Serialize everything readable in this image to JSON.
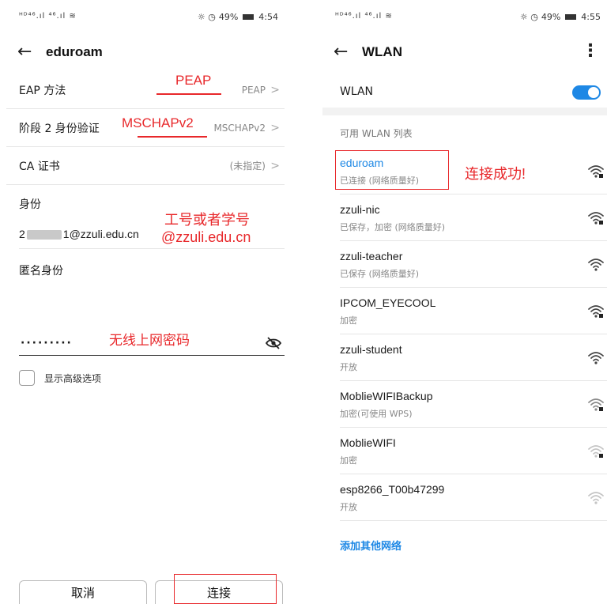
{
  "left": {
    "status": {
      "signal": "ᴴᴰ⁴⁶.ıl ⁴⁶.ıl ≋",
      "right": "49%",
      "icons": "☼ ◷",
      "time": "4:54"
    },
    "header": {
      "back_icon": "←",
      "title": "eduroam"
    },
    "rows": [
      {
        "label": "EAP 方法",
        "value": "PEAP",
        "chevron": ">"
      },
      {
        "label": "阶段 2 身份验证",
        "value": "MSCHAPv2",
        "chevron": ">"
      },
      {
        "label": "CA 证书",
        "value": "(未指定)",
        "chevron": ">"
      }
    ],
    "identity_label": "身份",
    "identity_prefix": "2",
    "identity_suffix": "1@zzuli.edu.cn",
    "anon_label": "匿名身份",
    "password_dots": "·········",
    "checkbox_label": "显示高级选项",
    "cancel_label": "取消",
    "connect_label": "连接",
    "annotations": {
      "peap": "PEAP",
      "mschap": "MSCHAPv2",
      "id_hint_line1": "工号或者学号",
      "id_hint_line2": "@zzuli.edu.cn",
      "password_hint": "无线上网密码"
    }
  },
  "right": {
    "status": {
      "signal": "ᴴᴰ⁴⁶.ıl ⁴⁶.ıl ≋",
      "right": "49%",
      "icons": "☼ ◷",
      "time": "4:55"
    },
    "header": {
      "back_icon": "←",
      "title": "WLAN",
      "menu_icon": "⋮"
    },
    "wlan_label": "WLAN",
    "toggle_on": true,
    "section_title": "可用 WLAN 列表",
    "success_annotation": "连接成功!",
    "networks": [
      {
        "name": "eduroam",
        "status": "已连接 (网络质量好)",
        "secured": true,
        "strength": "strong"
      },
      {
        "name": "zzuli-nic",
        "status": "已保存，加密 (网络质量好)",
        "secured": true,
        "strength": "strong"
      },
      {
        "name": "zzuli-teacher",
        "status": "已保存 (网络质量好)",
        "secured": false,
        "strength": "strong"
      },
      {
        "name": "IPCOM_EYECOOL",
        "status": "加密",
        "secured": true,
        "strength": "strong"
      },
      {
        "name": "zzuli-student",
        "status": "开放",
        "secured": false,
        "strength": "strong"
      },
      {
        "name": "MoblieWIFIBackup",
        "status": "加密(可使用 WPS)",
        "secured": true,
        "strength": "medium"
      },
      {
        "name": "MoblieWIFI",
        "status": "加密",
        "secured": true,
        "strength": "weak"
      },
      {
        "name": "esp8266_T00b47299",
        "status": "开放",
        "secured": false,
        "strength": "weak"
      }
    ],
    "add_network": "添加其他网络"
  },
  "colors": {
    "accent": "#1e88e5",
    "annotation": "#e8282b"
  },
  "icons": {
    "back": "back-arrow-icon",
    "wifi": "wifi-icon",
    "eye": "eye-slash-icon",
    "menu": "more-vertical-icon"
  }
}
